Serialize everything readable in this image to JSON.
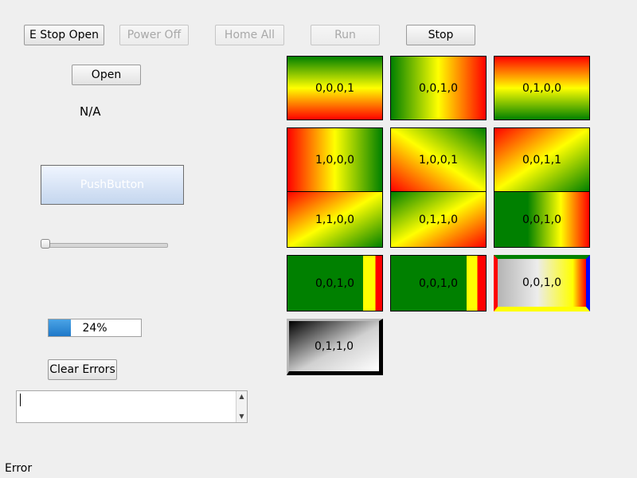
{
  "toolbar": {
    "estop_open": "E Stop Open",
    "power_off": "Power Off",
    "home_all": "Home All",
    "run": "Run",
    "stop": "Stop"
  },
  "left": {
    "open_label": "Open",
    "na_label": "N/A",
    "pushbutton_label": "PushButton",
    "slider_value": 0,
    "progress": {
      "value": 24,
      "text": "24%"
    },
    "clear_errors_label": "Clear Errors",
    "log_text": ""
  },
  "tiles": [
    {
      "label": "0,0,0,1"
    },
    {
      "label": "0,0,1,0"
    },
    {
      "label": "0,1,0,0"
    },
    {
      "label": "1,0,0,0"
    },
    {
      "label": "1,0,0,1"
    },
    {
      "label": "0,0,1,1"
    },
    {
      "label": "1,1,0,0"
    },
    {
      "label": "0,1,1,0"
    },
    {
      "label": "0,0,1,0"
    },
    {
      "label": "0,0,1,0"
    },
    {
      "label": "0,0,1,0"
    },
    {
      "label": "0,0,1,0"
    },
    {
      "label": "0,1,1,0"
    }
  ],
  "status_bar": {
    "text": "Error"
  },
  "icons": {
    "scroll_up": "triangle-up-icon",
    "scroll_down": "triangle-down-icon"
  },
  "colors": {
    "green": "#008000",
    "yellow": "#ffff00",
    "red": "#ff0000",
    "blue": "#0000ff",
    "progress_fill": "#2b84d2"
  }
}
